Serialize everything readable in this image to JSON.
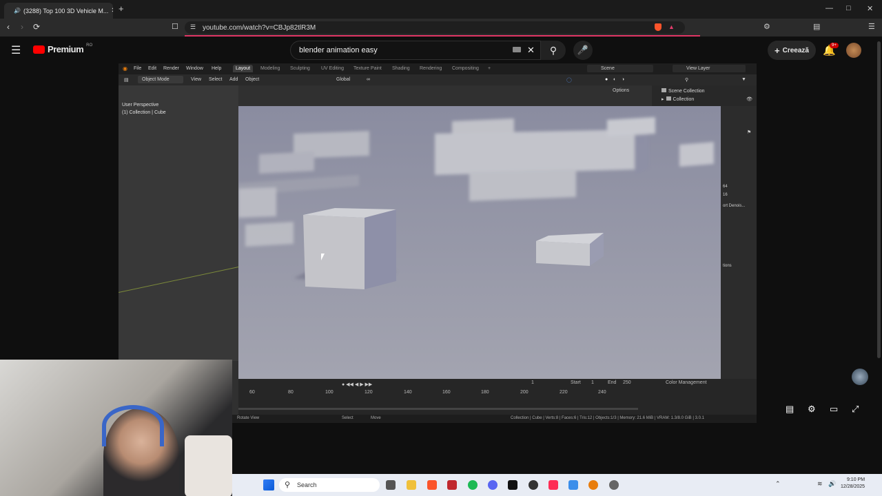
{
  "browser": {
    "tab_title": "(3288) Top 100 3D Vehicle M...",
    "url": "youtube.com/watch?v=CBJp82tlR3M"
  },
  "youtube": {
    "logo_text": "Premium",
    "logo_badge": "RO",
    "search_query": "blender animation easy",
    "create_label": "Creează",
    "notification_count": "9+"
  },
  "blender": {
    "menus": [
      "File",
      "Edit",
      "Render",
      "Window",
      "Help"
    ],
    "workspaces": [
      "Layout",
      "Modeling",
      "Sculpting",
      "UV Editing",
      "Texture Paint",
      "Shading",
      "Rendering",
      "Compositing"
    ],
    "active_workspace": "Layout",
    "scene_label": "Scene",
    "view_layer_label": "View Layer",
    "mode": "Object Mode",
    "header_menus": [
      "View",
      "Select",
      "Add",
      "Object"
    ],
    "transform_orientation": "Global",
    "options_label": "Options",
    "viewport_info": [
      "User Perspective",
      "(1) Collection | Cube"
    ],
    "outliner": {
      "scene_collection": "Scene Collection",
      "collection": "Collection"
    },
    "props_values": [
      "64",
      "16",
      "ort Denois...",
      "tions",
      "Color Management"
    ],
    "timeline_ticks": [
      "60",
      "80",
      "100",
      "120",
      "140",
      "160",
      "180",
      "200",
      "220",
      "240"
    ],
    "timeline_fields": {
      "current": "1",
      "start_label": "Start",
      "start": "1",
      "end_label": "End",
      "end": "250"
    },
    "status_left": "Rotate View",
    "status_select": "Select",
    "status_move": "Move",
    "status_right": "Collection | Cube | Verts:8 | Faces:6 | Tris:12 | Objects:1/3 | Memory: 21.6 MiB | VRAM: 1.3/8.0 GiB | 3.0.1"
  },
  "taskbar": {
    "search_placeholder": "Search",
    "time": "9:10 PM",
    "date": "12/28/2025"
  },
  "colors": {
    "youtube_red": "#ff0000",
    "blender_active_tab": "#3d3d3d",
    "accent_blue": "#4772b3"
  }
}
